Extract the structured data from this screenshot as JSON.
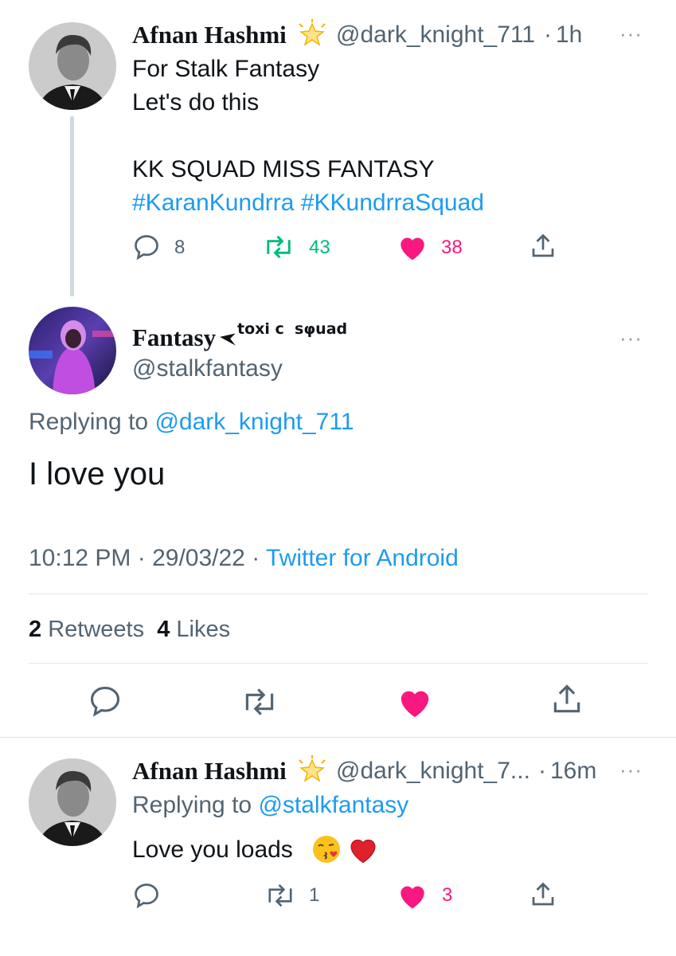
{
  "tweet1": {
    "name": "Afnan Hashmi",
    "badge": "star-icon",
    "handle": "@dark_knight_711",
    "sep": "·",
    "time": "1h",
    "line1": "For Stalk Fantasy",
    "line2": "Let's do this",
    "line3": "KK SQUAD MISS FANTASY",
    "hashtag1": "#KaranKundrra",
    "hashtag2": "#KKundrraSquad",
    "replies": "8",
    "retweets": "43",
    "likes": "38"
  },
  "main_tweet": {
    "name": "Fantasy",
    "name_suffix": "toxi c  sφuad",
    "handle": "@stalkfantasy",
    "replying_prefix": "Replying to",
    "replying_handle": "@dark_knight_711",
    "text": "I love you",
    "timestamp": "10:12 PM · 29/03/22",
    "sep": "·",
    "source": "Twitter for Android",
    "retweet_count": "2",
    "retweet_label": "Retweets",
    "like_count": "4",
    "like_label": "Likes"
  },
  "tweet3": {
    "name": "Afnan Hashmi",
    "handle": "@dark_knight_7...",
    "sep": "·",
    "time": "16m",
    "replying_prefix": "Replying to",
    "replying_handle": "@stalkfantasy",
    "text": "Love you loads",
    "retweets": "1",
    "likes": "3"
  },
  "more": "···",
  "colors": {
    "accent": "#1d9bf0",
    "like": "#f91880",
    "retweet": "#00ba7c",
    "secondary": "#536471"
  }
}
